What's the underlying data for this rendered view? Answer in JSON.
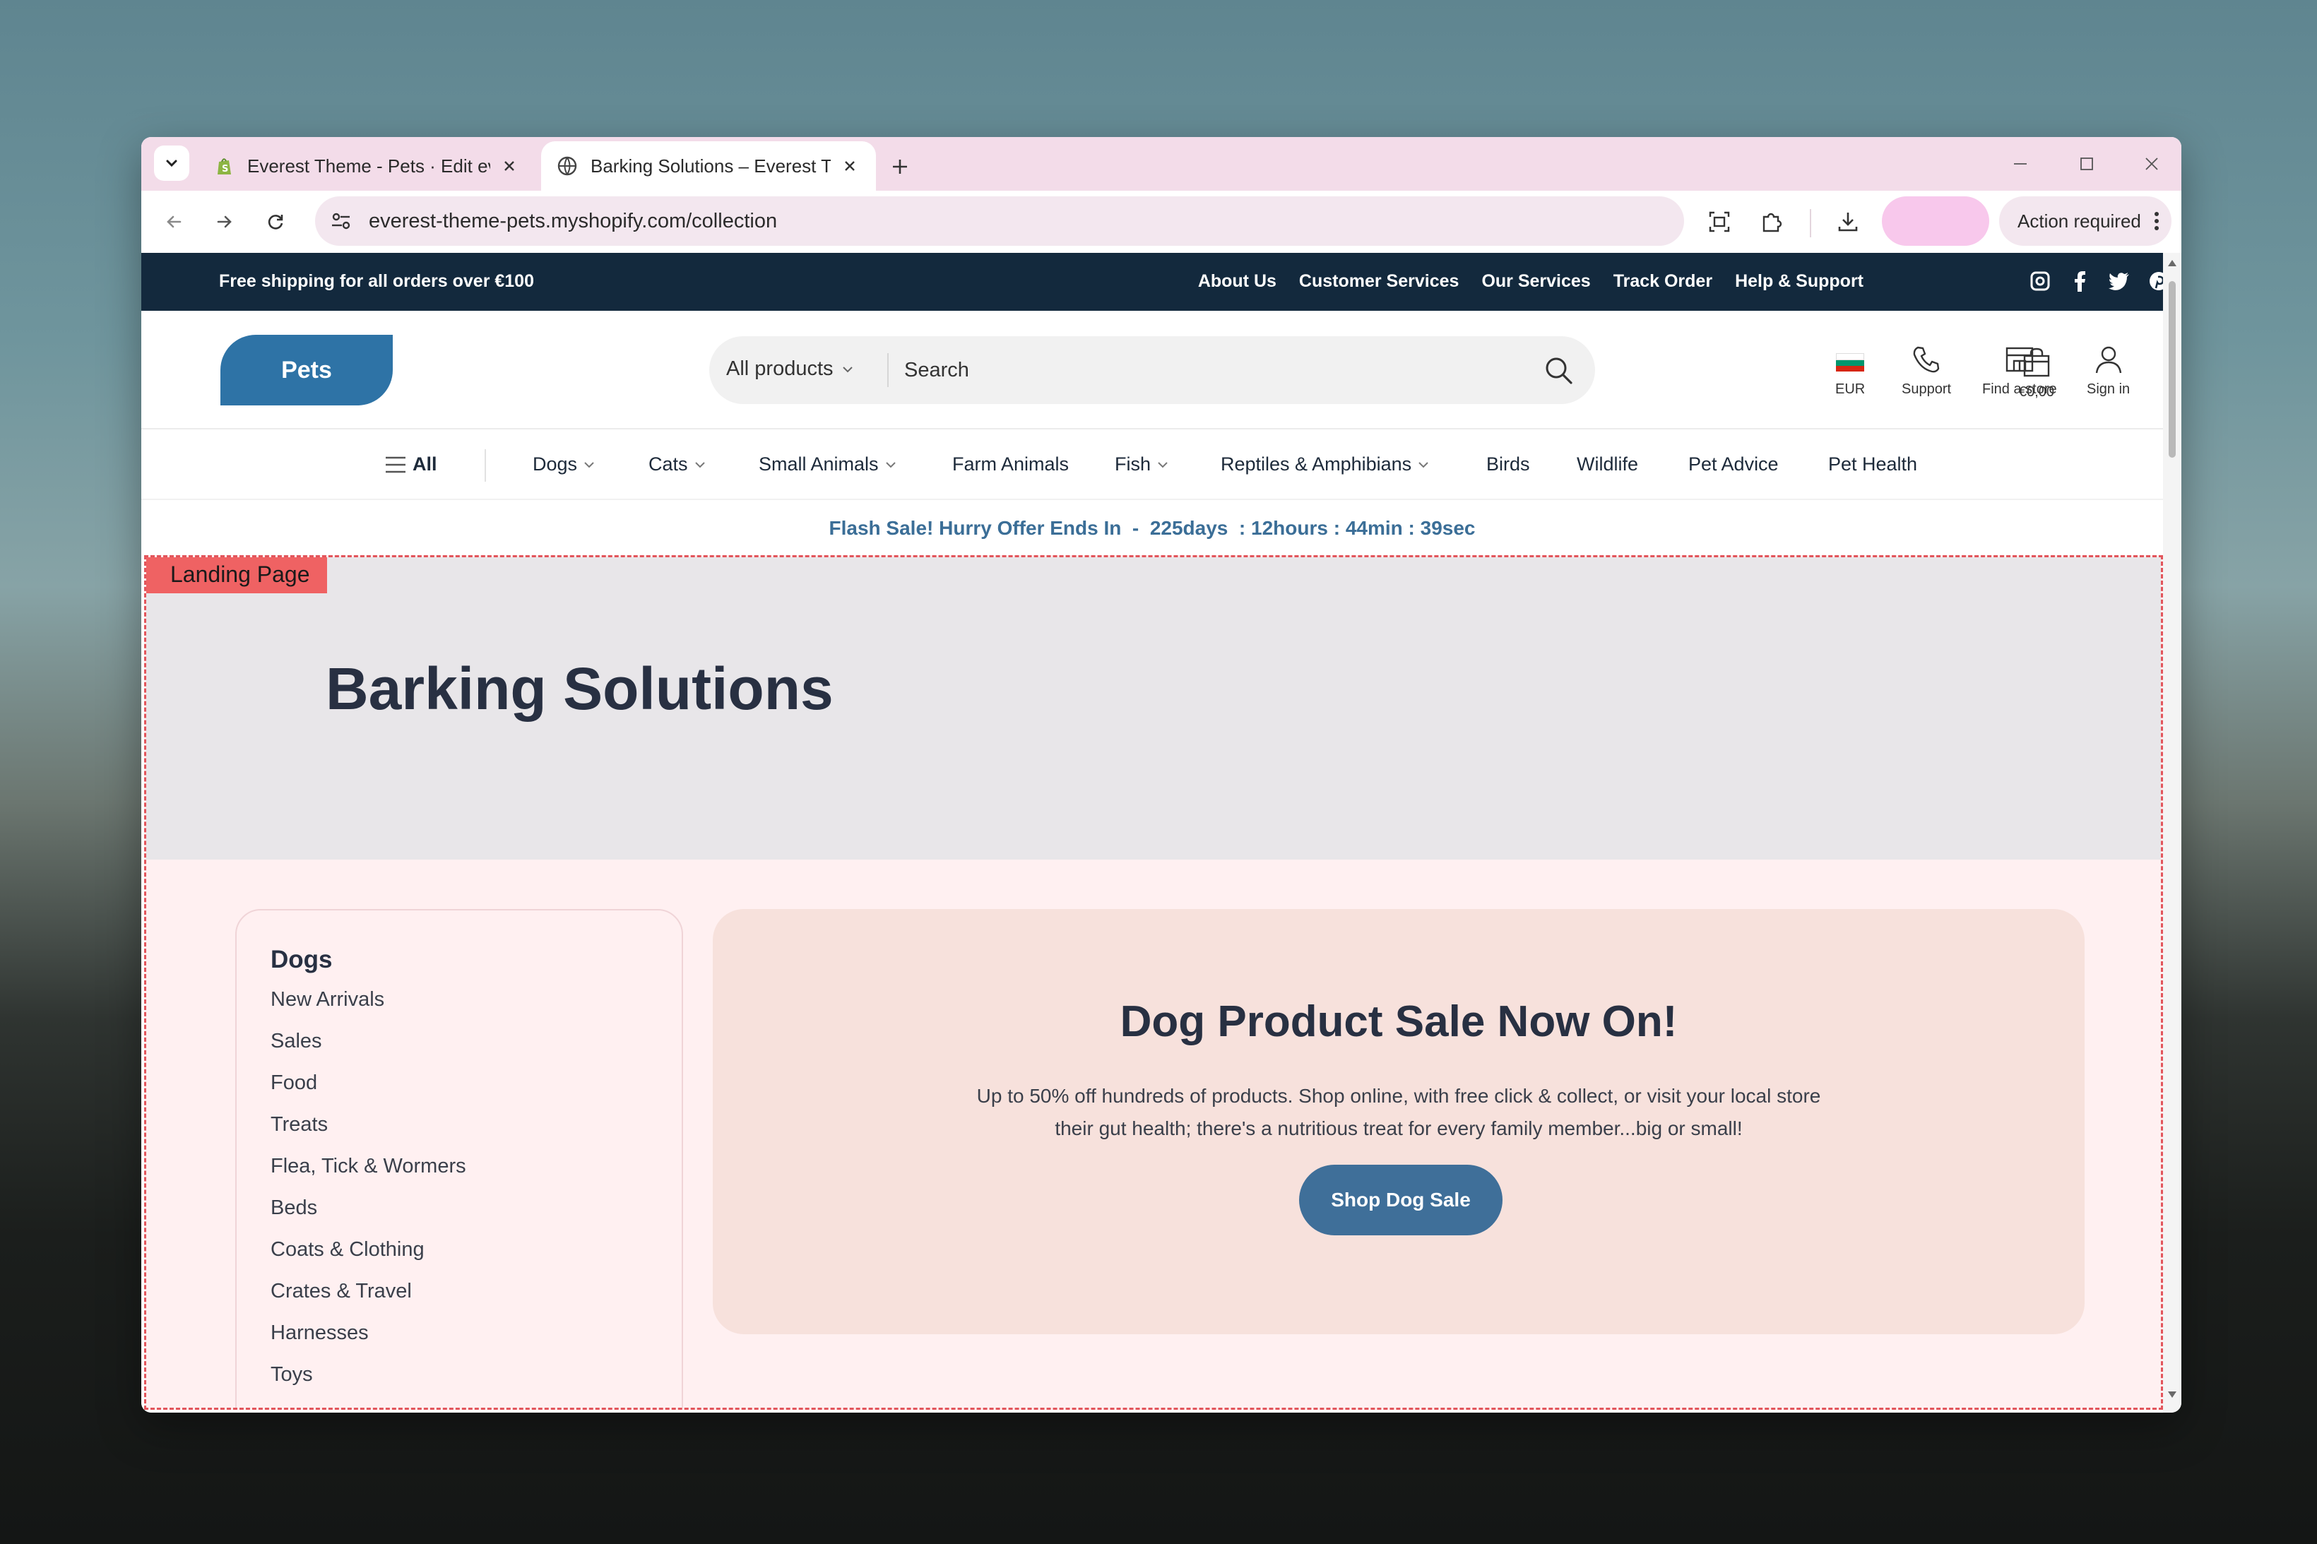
{
  "browser": {
    "tabs": [
      {
        "title": "Everest Theme - Pets · Edit everest",
        "active": false
      },
      {
        "title": "Barking Solutions – Everest Theme",
        "active": true
      }
    ],
    "url": "everest-theme-pets.myshopify.com/collection",
    "action_label": "Action required"
  },
  "announcement": {
    "shipping": "Free shipping for all orders over €100",
    "links": [
      "About Us",
      "Customer Services",
      "Our Services",
      "Track Order",
      "Help & Support"
    ],
    "social_icons": [
      "instagram-icon",
      "facebook-icon",
      "twitter-icon",
      "pinterest-icon",
      "youtube-icon"
    ]
  },
  "header": {
    "logo": "Pets",
    "search_category": "All products",
    "search_placeholder": "Search",
    "currency": "EUR",
    "support": "Support",
    "find_store": "Find a store",
    "sign_in": "Sign in",
    "cart_total": "€0,00"
  },
  "nav": {
    "all": "All",
    "items": [
      {
        "label": "Dogs",
        "dropdown": true
      },
      {
        "label": "Cats",
        "dropdown": true
      },
      {
        "label": "Small Animals",
        "dropdown": true
      },
      {
        "label": "Farm Animals",
        "dropdown": false
      },
      {
        "label": "Fish",
        "dropdown": true
      },
      {
        "label": "Reptiles & Amphibians",
        "dropdown": true
      },
      {
        "label": "Birds",
        "dropdown": false
      },
      {
        "label": "Wildlife",
        "dropdown": false
      },
      {
        "label": "Pet Advice",
        "dropdown": false
      },
      {
        "label": "Pet Health",
        "dropdown": false
      }
    ]
  },
  "flash": {
    "text": "Flash Sale! Hurry Offer Ends In  -  225days  : 12hours : 44min : 39sec"
  },
  "landing": {
    "tag": "Landing Page",
    "title": "Barking Solutions",
    "sidebar": {
      "heading": "Dogs",
      "items": [
        "New Arrivals",
        "Sales",
        "Food",
        "Treats",
        "Flea, Tick & Wormers",
        "Beds",
        "Coats & Clothing",
        "Crates & Travel",
        "Harnesses",
        "Toys"
      ]
    },
    "promo": {
      "title": "Dog Product Sale Now On!",
      "line1": "Up to 50% off hundreds of products. Shop online, with free click & collect, or visit your local store",
      "line2": "their gut health; there's a nutritious treat for every family member...big or small!",
      "cta": "Shop Dog Sale"
    }
  },
  "colors": {
    "announcement_bg": "#13293d",
    "brand_blue": "#2e73a6",
    "flash_text": "#3b6e97",
    "cta_bg": "#3f6f99",
    "landing_outline": "#e2555b",
    "tabbar_bg": "#f3dce9"
  }
}
